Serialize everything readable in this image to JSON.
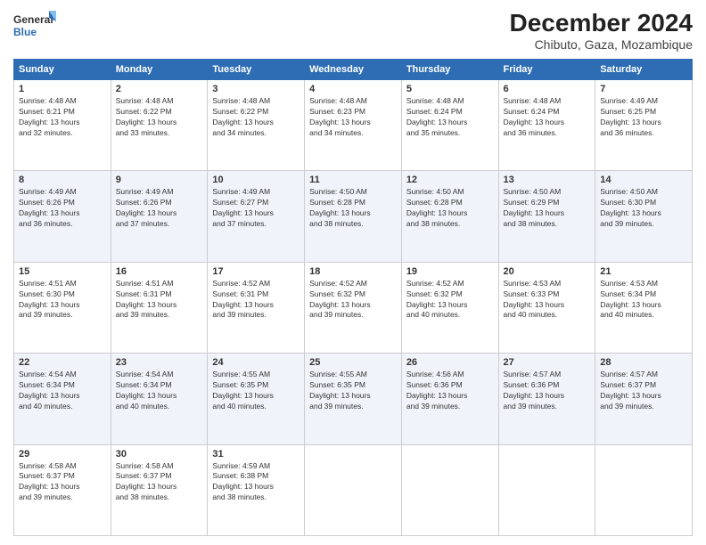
{
  "header": {
    "logo_line1": "General",
    "logo_line2": "Blue",
    "main_title": "December 2024",
    "sub_title": "Chibuto, Gaza, Mozambique"
  },
  "days_of_week": [
    "Sunday",
    "Monday",
    "Tuesday",
    "Wednesday",
    "Thursday",
    "Friday",
    "Saturday"
  ],
  "weeks": [
    [
      {
        "day": 1,
        "info": "Sunrise: 4:48 AM\nSunset: 6:21 PM\nDaylight: 13 hours\nand 32 minutes."
      },
      {
        "day": 2,
        "info": "Sunrise: 4:48 AM\nSunset: 6:22 PM\nDaylight: 13 hours\nand 33 minutes."
      },
      {
        "day": 3,
        "info": "Sunrise: 4:48 AM\nSunset: 6:22 PM\nDaylight: 13 hours\nand 34 minutes."
      },
      {
        "day": 4,
        "info": "Sunrise: 4:48 AM\nSunset: 6:23 PM\nDaylight: 13 hours\nand 34 minutes."
      },
      {
        "day": 5,
        "info": "Sunrise: 4:48 AM\nSunset: 6:24 PM\nDaylight: 13 hours\nand 35 minutes."
      },
      {
        "day": 6,
        "info": "Sunrise: 4:48 AM\nSunset: 6:24 PM\nDaylight: 13 hours\nand 36 minutes."
      },
      {
        "day": 7,
        "info": "Sunrise: 4:49 AM\nSunset: 6:25 PM\nDaylight: 13 hours\nand 36 minutes."
      }
    ],
    [
      {
        "day": 8,
        "info": "Sunrise: 4:49 AM\nSunset: 6:26 PM\nDaylight: 13 hours\nand 36 minutes."
      },
      {
        "day": 9,
        "info": "Sunrise: 4:49 AM\nSunset: 6:26 PM\nDaylight: 13 hours\nand 37 minutes."
      },
      {
        "day": 10,
        "info": "Sunrise: 4:49 AM\nSunset: 6:27 PM\nDaylight: 13 hours\nand 37 minutes."
      },
      {
        "day": 11,
        "info": "Sunrise: 4:50 AM\nSunset: 6:28 PM\nDaylight: 13 hours\nand 38 minutes."
      },
      {
        "day": 12,
        "info": "Sunrise: 4:50 AM\nSunset: 6:28 PM\nDaylight: 13 hours\nand 38 minutes."
      },
      {
        "day": 13,
        "info": "Sunrise: 4:50 AM\nSunset: 6:29 PM\nDaylight: 13 hours\nand 38 minutes."
      },
      {
        "day": 14,
        "info": "Sunrise: 4:50 AM\nSunset: 6:30 PM\nDaylight: 13 hours\nand 39 minutes."
      }
    ],
    [
      {
        "day": 15,
        "info": "Sunrise: 4:51 AM\nSunset: 6:30 PM\nDaylight: 13 hours\nand 39 minutes."
      },
      {
        "day": 16,
        "info": "Sunrise: 4:51 AM\nSunset: 6:31 PM\nDaylight: 13 hours\nand 39 minutes."
      },
      {
        "day": 17,
        "info": "Sunrise: 4:52 AM\nSunset: 6:31 PM\nDaylight: 13 hours\nand 39 minutes."
      },
      {
        "day": 18,
        "info": "Sunrise: 4:52 AM\nSunset: 6:32 PM\nDaylight: 13 hours\nand 39 minutes."
      },
      {
        "day": 19,
        "info": "Sunrise: 4:52 AM\nSunset: 6:32 PM\nDaylight: 13 hours\nand 40 minutes."
      },
      {
        "day": 20,
        "info": "Sunrise: 4:53 AM\nSunset: 6:33 PM\nDaylight: 13 hours\nand 40 minutes."
      },
      {
        "day": 21,
        "info": "Sunrise: 4:53 AM\nSunset: 6:34 PM\nDaylight: 13 hours\nand 40 minutes."
      }
    ],
    [
      {
        "day": 22,
        "info": "Sunrise: 4:54 AM\nSunset: 6:34 PM\nDaylight: 13 hours\nand 40 minutes."
      },
      {
        "day": 23,
        "info": "Sunrise: 4:54 AM\nSunset: 6:34 PM\nDaylight: 13 hours\nand 40 minutes."
      },
      {
        "day": 24,
        "info": "Sunrise: 4:55 AM\nSunset: 6:35 PM\nDaylight: 13 hours\nand 40 minutes."
      },
      {
        "day": 25,
        "info": "Sunrise: 4:55 AM\nSunset: 6:35 PM\nDaylight: 13 hours\nand 39 minutes."
      },
      {
        "day": 26,
        "info": "Sunrise: 4:56 AM\nSunset: 6:36 PM\nDaylight: 13 hours\nand 39 minutes."
      },
      {
        "day": 27,
        "info": "Sunrise: 4:57 AM\nSunset: 6:36 PM\nDaylight: 13 hours\nand 39 minutes."
      },
      {
        "day": 28,
        "info": "Sunrise: 4:57 AM\nSunset: 6:37 PM\nDaylight: 13 hours\nand 39 minutes."
      }
    ],
    [
      {
        "day": 29,
        "info": "Sunrise: 4:58 AM\nSunset: 6:37 PM\nDaylight: 13 hours\nand 39 minutes."
      },
      {
        "day": 30,
        "info": "Sunrise: 4:58 AM\nSunset: 6:37 PM\nDaylight: 13 hours\nand 38 minutes."
      },
      {
        "day": 31,
        "info": "Sunrise: 4:59 AM\nSunset: 6:38 PM\nDaylight: 13 hours\nand 38 minutes."
      },
      null,
      null,
      null,
      null
    ]
  ]
}
